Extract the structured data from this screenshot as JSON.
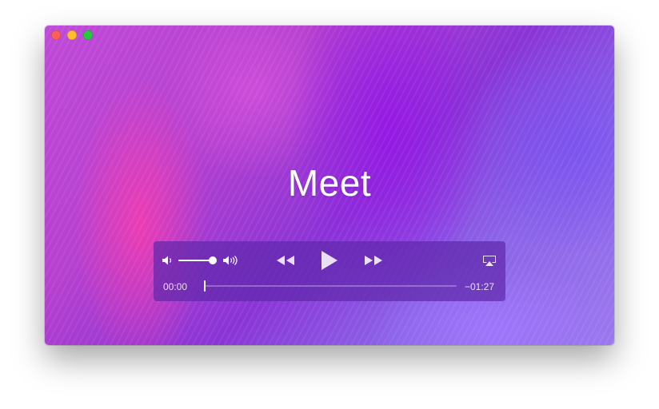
{
  "window": {
    "buttons": [
      "close",
      "minimize",
      "zoom"
    ]
  },
  "video": {
    "caption": "Meet"
  },
  "controls": {
    "volume_level": 0.95,
    "elapsed": "00:00",
    "remaining": "−01:27",
    "progress": 0.0,
    "icons": {
      "volume_low": "speaker-low-icon",
      "volume_high": "speaker-high-icon",
      "rewind": "rewind-icon",
      "play": "play-icon",
      "fast_forward": "fast-forward-icon",
      "airplay": "airplay-icon"
    }
  },
  "colors": {
    "control_bg": "#5f28aa",
    "close": "#fe5f57",
    "minimize": "#febc2e",
    "zoom": "#28c840"
  }
}
